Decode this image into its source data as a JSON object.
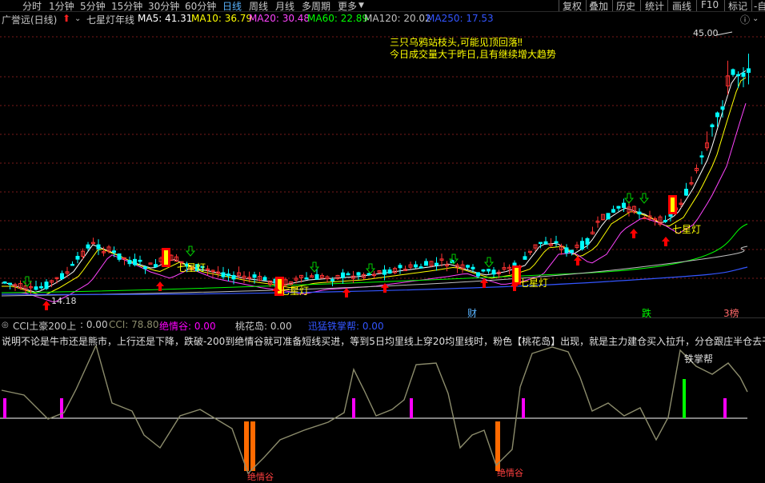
{
  "toolbar": {
    "periods": [
      "分时",
      "1分钟",
      "5分钟",
      "15分钟",
      "30分钟",
      "60分钟",
      "日线",
      "周线",
      "月线",
      "多周期",
      "更多"
    ],
    "active_period": "日线",
    "right_buttons": [
      "复权",
      "叠加",
      "历史",
      "统计",
      "画线",
      "F10",
      "标记",
      "-自"
    ]
  },
  "indicator_bar": {
    "stock": "广誉远(日线)",
    "indicator_name": "七星灯年线",
    "ma5": "MA5: 41.31",
    "ma10": "MA10: 36.79",
    "ma20": "MA20: 30.48",
    "ma60": "MA60: 22.89",
    "ma120": "MA120: 20.02",
    "ma250": "MA250: 17.53",
    "colors": {
      "ma5": "#ffffff",
      "ma10": "#ffff00",
      "ma20": "#ff44ff",
      "ma60": "#00ff00",
      "ma120": "#c0c0c0",
      "ma250": "#3355ff"
    }
  },
  "main_chart": {
    "note_line1": "三只乌鸦站枝头,可能见顶回落‼",
    "note_line2": "今日成交量大于昨日,且有继续增大趋势",
    "high_label": "45.00",
    "low_label": "14.18",
    "signal_label": "七星灯",
    "bottom_markers": [
      "财",
      "跌",
      "3榜"
    ],
    "colors": {
      "up": "#ff3232",
      "down": "#00ffff",
      "signal_red": "#ff0000",
      "signal_yellow": "#ffff00",
      "signal_green": "#00cc00"
    }
  },
  "sub_chart": {
    "title": "CCI土豪200上",
    "v1": ": 0.00",
    "cci": "CCI: 78.80",
    "jue_qing_gu": "绝情谷: 0.00",
    "tao_hua_dao": "桃花岛: 0.00",
    "tie_zhang_bang": "迅猛铁掌帮: 0.00",
    "description": "说明不论是牛市还是熊市，上行还是下降，跌破-200到绝情谷就可准备短线买进，等到5日均里线上穿20均里线时，粉色【桃花岛】出现，就是主力建仓买入拉升，分仓跟庄半仓去干",
    "label_tie": "铁掌帮",
    "label_jue": "绝情谷",
    "colors": {
      "cci": "#8c8c6c",
      "pink": "#ff00ff",
      "orange": "#ff6a00",
      "green": "#00ff00",
      "zero": "#ffffff"
    }
  }
}
